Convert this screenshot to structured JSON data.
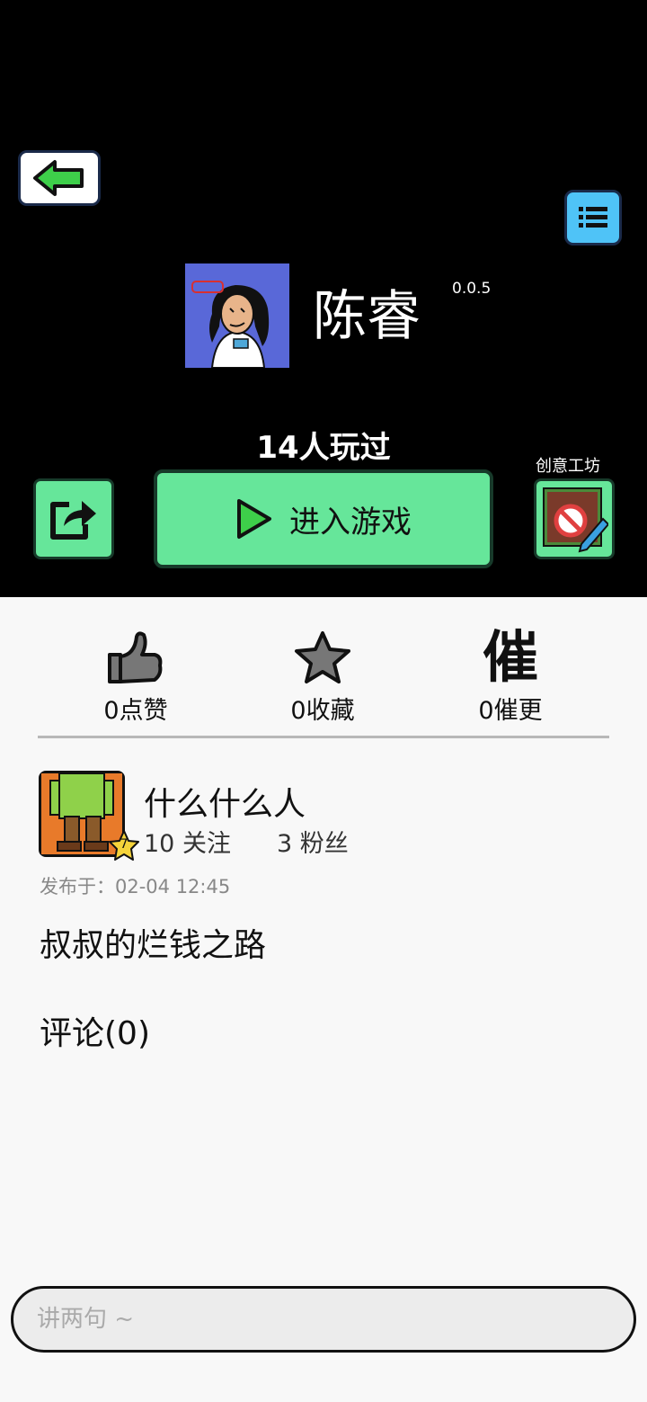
{
  "game": {
    "title": "陈睿",
    "version": "0.0.5",
    "played_count": "14人玩过"
  },
  "actions": {
    "enter_label": "进入游戏",
    "workshop_label": "创意工坊"
  },
  "stats": [
    {
      "label": "0点赞",
      "icon": "thumbs-up-icon"
    },
    {
      "label": "0收藏",
      "icon": "star-icon"
    },
    {
      "label": "0催更",
      "icon": "cui-icon",
      "glyph": "催"
    }
  ],
  "author": {
    "name": "什么什么人",
    "follow": "10 关注",
    "fans": "3 粉丝",
    "level": "7"
  },
  "post": {
    "published": "发布于：02-04 12:45",
    "description": "叔叔的烂钱之路",
    "comments": "评论(0)"
  },
  "comment_input": {
    "placeholder": "讲两句 ~"
  },
  "colors": {
    "accent_green": "#66e69a",
    "menu_blue": "#4fc3f7"
  }
}
